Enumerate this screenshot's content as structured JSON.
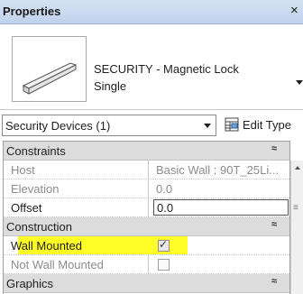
{
  "panel": {
    "title": "Properties",
    "close_glyph": "×"
  },
  "type_selector": {
    "line1": "SECURITY - Magnetic Lock",
    "line2": "Single",
    "thumbnail_icon": "magnetic-lock-preview-icon"
  },
  "filter": {
    "selected": "Security Devices (1)",
    "edit_type_label": "Edit Type",
    "edit_type_icon": "edit-type-icon"
  },
  "groups": {
    "constraints": {
      "label": "Constraints",
      "collapse_glyph": "≈",
      "rows": [
        {
          "name": "Host",
          "value": "Basic Wall : 90T_25Li...",
          "readonly": true
        },
        {
          "name": "Elevation",
          "value": "0.0",
          "readonly": true
        },
        {
          "name": "Offset",
          "value": "0.0",
          "readonly": false
        }
      ]
    },
    "construction": {
      "label": "Construction",
      "collapse_glyph": "≈",
      "rows": [
        {
          "name": "Wall Mounted",
          "checked": true,
          "highlighted": true
        },
        {
          "name": "Not Wall Mounted",
          "checked": false,
          "readonly": true
        }
      ]
    },
    "graphics": {
      "label": "Graphics",
      "collapse_glyph": "≈"
    }
  },
  "colors": {
    "highlight": "#ffff27",
    "header_bg": "#c0d2ec",
    "group_bg": "#dcdcdc"
  }
}
